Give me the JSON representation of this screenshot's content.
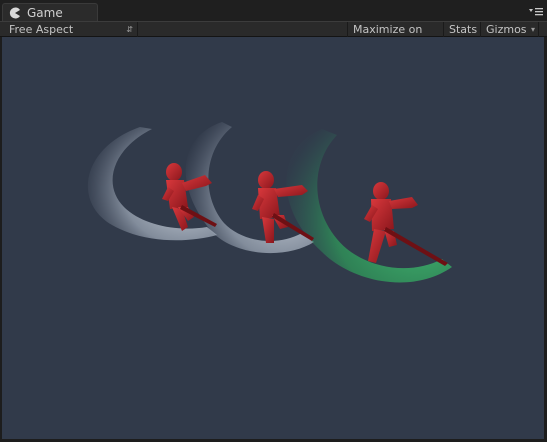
{
  "tab": {
    "title": "Game",
    "icon": "pacman-icon"
  },
  "toolbar": {
    "aspect_label": "Free Aspect",
    "maximize_label": "Maximize on Play",
    "stats_label": "Stats",
    "gizmos_label": "Gizmos"
  },
  "viewport": {
    "background": "#313a4a",
    "characters": [
      {
        "trail_color": "white"
      },
      {
        "trail_color": "white"
      },
      {
        "trail_color": "green"
      }
    ]
  },
  "colors": {
    "editor_bg": "#1d1d1d",
    "character_red": "#b8282e",
    "trail_green": "#3fbf6a",
    "trail_white": "#dfe6ef"
  }
}
